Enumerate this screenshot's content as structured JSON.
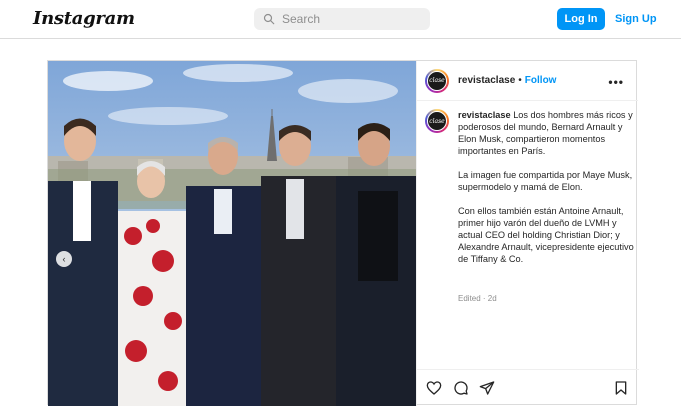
{
  "topbar": {
    "logo": "Instagram",
    "search_placeholder": "Search",
    "login_label": "Log In",
    "signup_label": "Sign Up"
  },
  "post": {
    "username": "revistaclase",
    "avatar_text": "clase",
    "follow_label": "Follow",
    "more_label": "•••",
    "caption_username": "revistaclase",
    "caption_paragraphs": [
      "Los dos hombres más ricos y poderosos del mundo, Bernard Arnault y Elon Musk, compartieron momentos importantes en París.",
      "La imagen fue compartida por Maye Musk, supermodelo y mamá de Elon.",
      "Con ellos también están Antoine Arnault, primer hijo varón del dueño de LVMH y actual CEO del holding Christian Dior; y Alexandre Arnault, vicepresidente ejecutivo de Tiffany & Co."
    ],
    "edited": "Edited · 2d",
    "prev_arrow": "‹"
  },
  "icons": {
    "search": "search-icon",
    "like": "heart-icon",
    "comment": "comment-icon",
    "share": "share-icon",
    "save": "bookmark-icon",
    "more": "more-icon"
  },
  "colors": {
    "accent": "#0095f6",
    "border": "#dbdbdb",
    "text": "#262626",
    "muted": "#8e8e8e"
  }
}
